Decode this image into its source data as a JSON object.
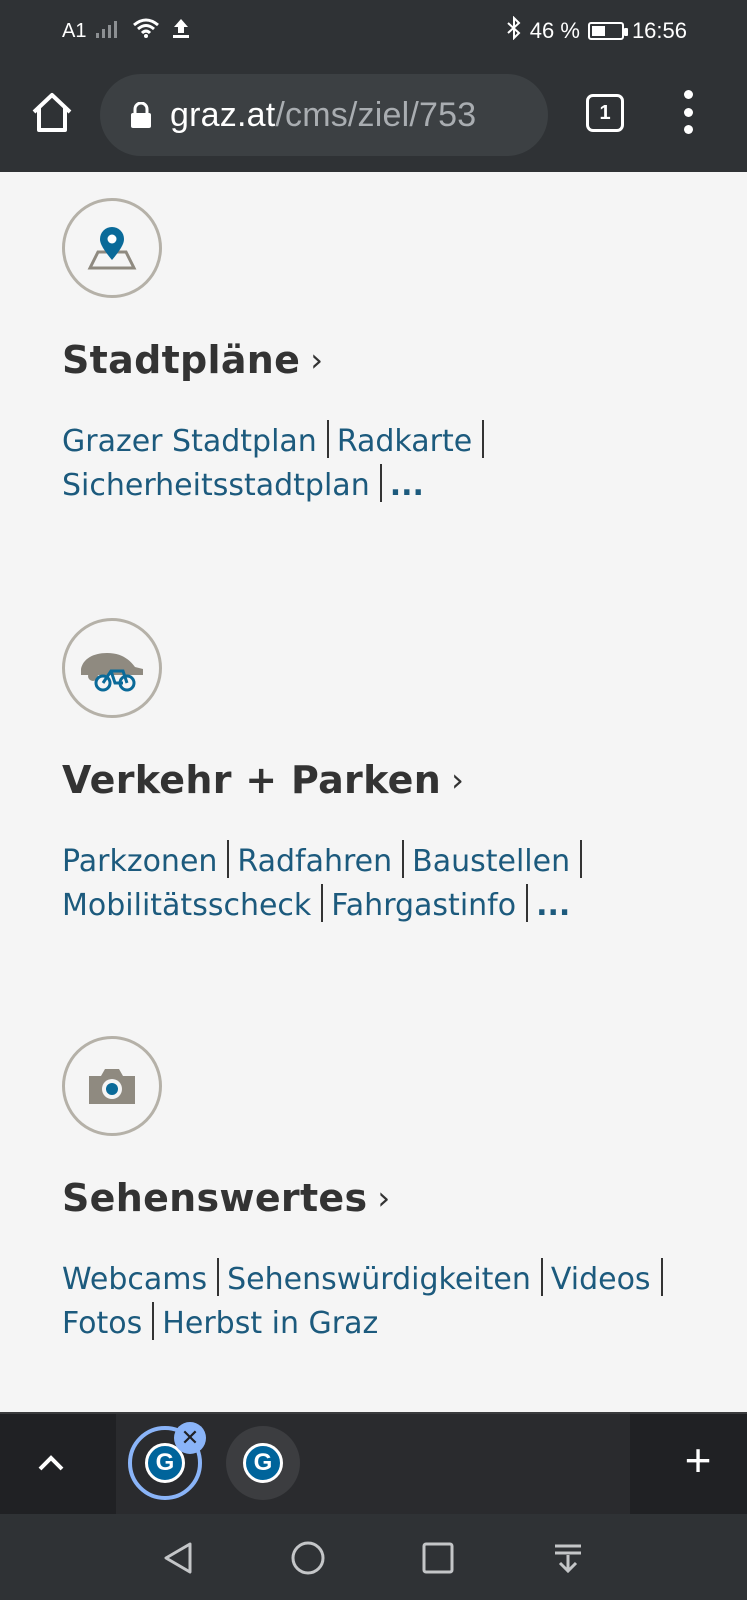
{
  "status_bar": {
    "carrier": "A1",
    "bluetooth_icon": "bluetooth-icon",
    "battery_percent": "46 %",
    "battery_level": 0.46,
    "time": "16:56"
  },
  "browser": {
    "url_host": "graz.at",
    "url_path": "/cms/ziel/753",
    "tab_count": "1"
  },
  "sections": [
    {
      "icon": "map-pin-icon",
      "title": "Stadtpläne",
      "links": [
        "Grazer Stadtplan",
        "Radkarte",
        "Sicherheitsstadtplan"
      ],
      "more": "..."
    },
    {
      "icon": "car-bike-icon",
      "title": "Verkehr + Parken",
      "links": [
        "Parkzonen",
        "Radfahren",
        "Baustellen",
        "Mobilitätsscheck",
        "Fahrgastinfo"
      ],
      "more": "..."
    },
    {
      "icon": "camera-icon",
      "title": "Sehenswertes",
      "links": [
        "Webcams",
        "Sehenswürdigkeiten",
        "Videos",
        "Fotos",
        "Herbst in Graz"
      ]
    }
  ],
  "tab_strip": {
    "favicon_letter": "G",
    "close_symbol": "✕",
    "new_tab_symbol": "+"
  },
  "colors": {
    "link": "#1c5a7d",
    "heading": "#333333",
    "chrome": "#2f3235",
    "accent": "#8ab4f8"
  }
}
